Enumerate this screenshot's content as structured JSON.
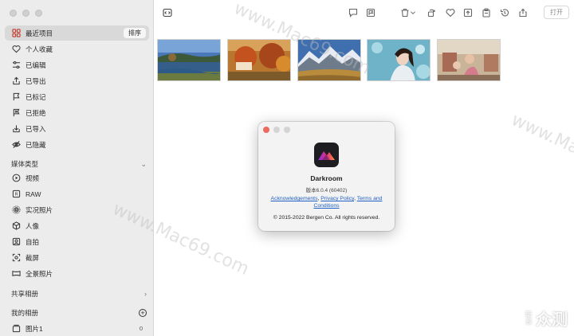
{
  "sidebar": {
    "items": [
      {
        "label": "最近项目",
        "icon": "grid-icon"
      },
      {
        "label": "个人收藏",
        "icon": "heart-icon"
      },
      {
        "label": "已编辑",
        "icon": "slider-icon"
      },
      {
        "label": "已导出",
        "icon": "export-icon"
      },
      {
        "label": "已标记",
        "icon": "flag-icon"
      },
      {
        "label": "已拒绝",
        "icon": "reject-flag-icon"
      },
      {
        "label": "已导入",
        "icon": "import-icon"
      },
      {
        "label": "已隐藏",
        "icon": "hidden-icon"
      }
    ],
    "sort_label": "排序",
    "media_section": "媒体类型",
    "media_items": [
      {
        "label": "视频",
        "icon": "play-icon"
      },
      {
        "label": "RAW",
        "icon": "raw-icon"
      },
      {
        "label": "实况照片",
        "icon": "live-photo-icon"
      },
      {
        "label": "人像",
        "icon": "cube-icon"
      },
      {
        "label": "自拍",
        "icon": "selfie-icon"
      },
      {
        "label": "截屏",
        "icon": "screenshot-icon"
      },
      {
        "label": "全景照片",
        "icon": "panorama-icon"
      }
    ],
    "shared_section": "共享相册",
    "my_albums_section": "我的相册",
    "albums": [
      {
        "label": "图片1",
        "count": "0",
        "icon": "album-icon"
      }
    ]
  },
  "toolbar": {
    "open_label": "打开",
    "icons": [
      "sidebar-toggle-icon",
      "comment-icon",
      "flag-icon",
      "trash-icon",
      "chevron-down-icon",
      "rotate-icon",
      "heart-icon",
      "export-icon",
      "clipboard-icon",
      "history-icon",
      "share-icon"
    ]
  },
  "about": {
    "app_name": "Darkroom",
    "version": "版本6.0.4 (60402)",
    "link1": "Acknowledgements",
    "sep1": ", ",
    "link2": "Privacy Policy",
    "sep2": ", ",
    "link3": "Terms and Conditions",
    "copyright": "© 2015-2022 Bergen Co. All rights reserved."
  },
  "watermarks": {
    "text": "www.Mac69.com",
    "brand_small": "新浪",
    "brand_big": "众测"
  },
  "colors": {
    "sidebar_bg": "#ececec",
    "active_item": "#d9d9d9",
    "link": "#1f5fc2",
    "close": "#ed6a5e"
  }
}
